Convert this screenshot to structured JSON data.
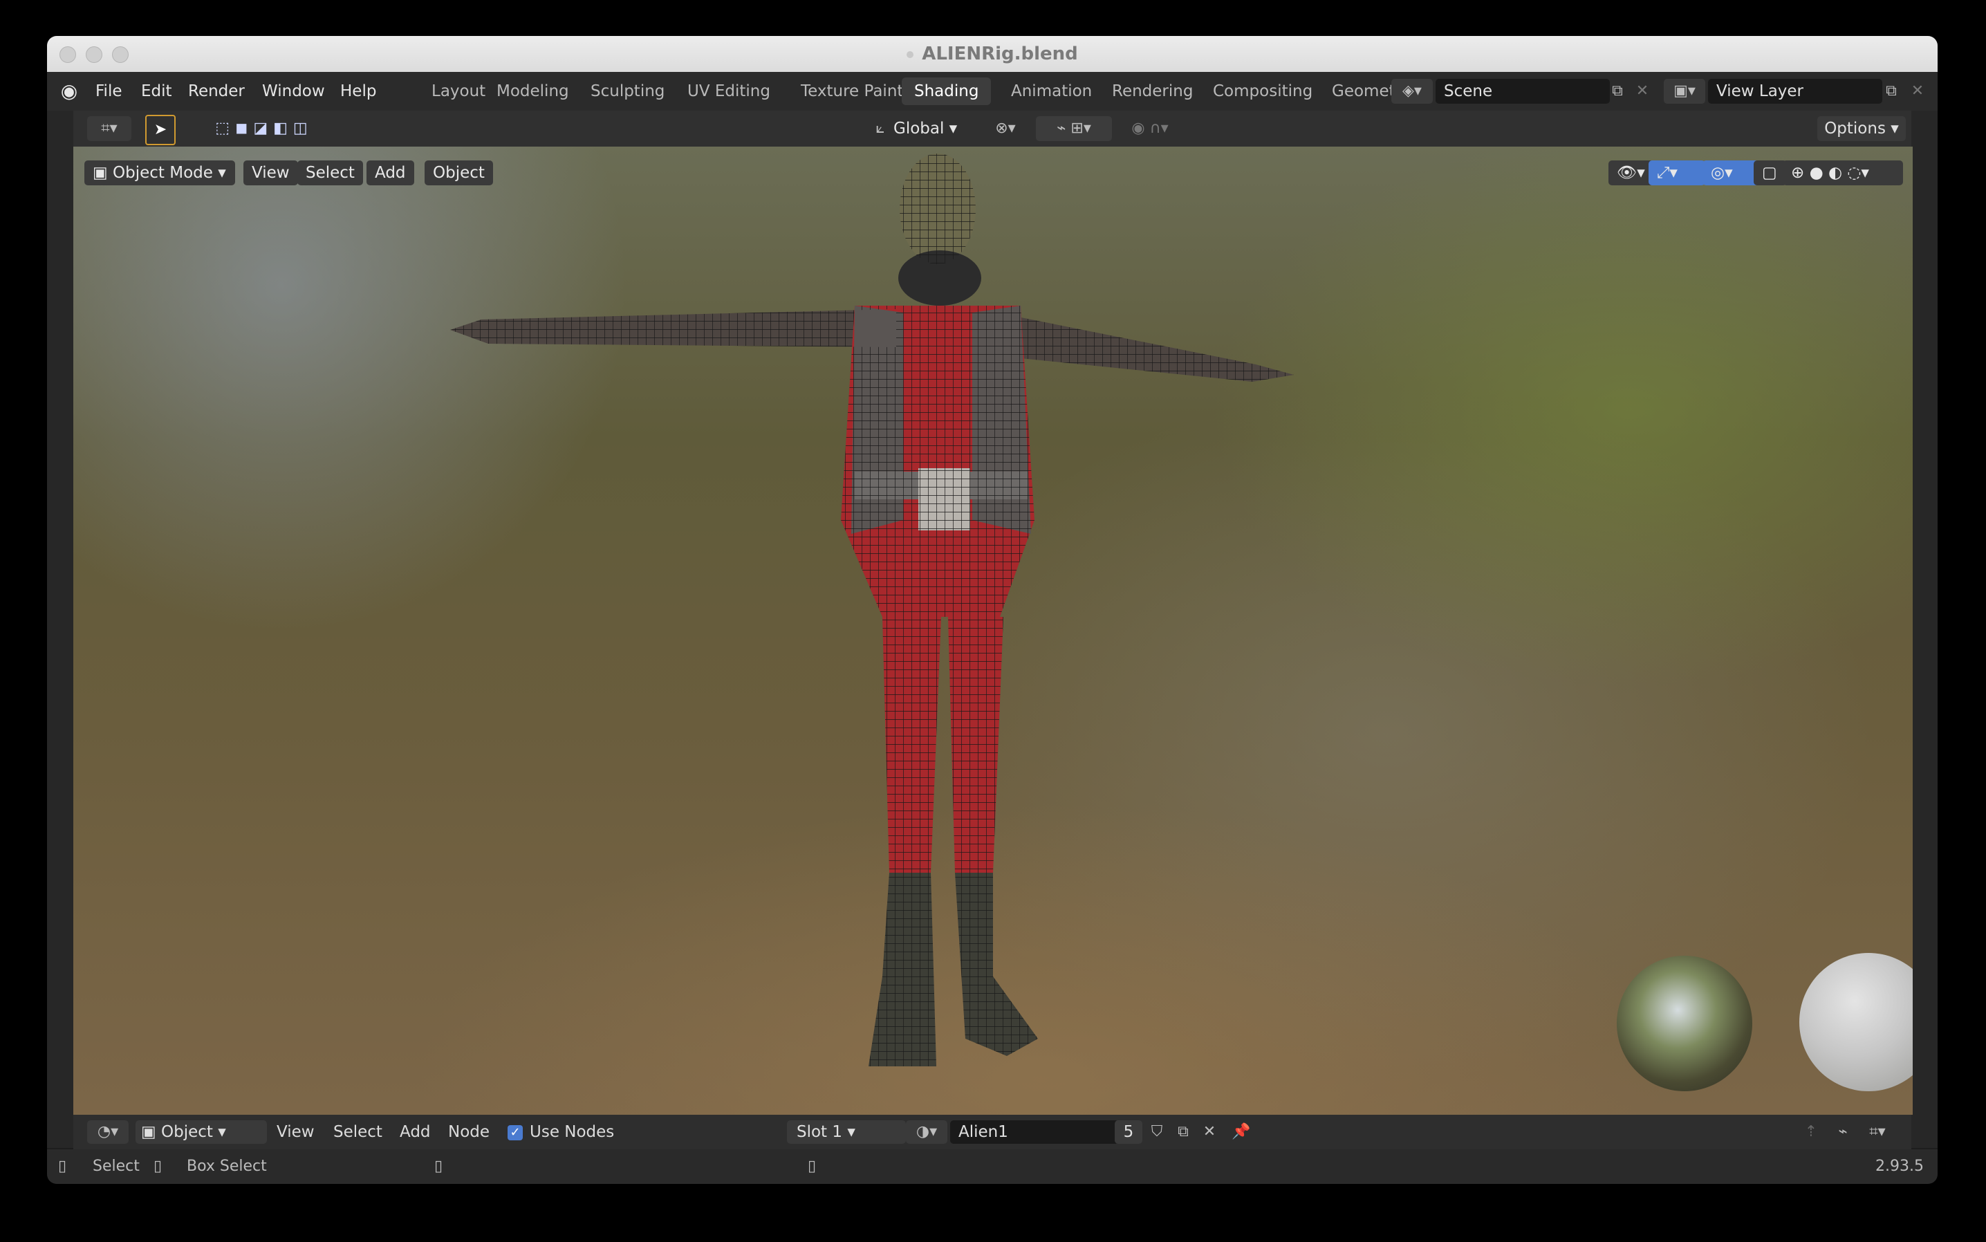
{
  "window": {
    "title": "ALIENRig.blend"
  },
  "menu": [
    "File",
    "Edit",
    "Render",
    "Window",
    "Help"
  ],
  "workspaces": {
    "tabs": [
      "Layout",
      "Modeling",
      "Sculpting",
      "UV Editing",
      "Texture Paint",
      "Shading",
      "Animation",
      "Rendering",
      "Compositing",
      "Geomet"
    ],
    "active": "Shading"
  },
  "scene": {
    "name": "Scene"
  },
  "view_layer": {
    "name": "View Layer"
  },
  "toolbar": {
    "orientation": "Global",
    "options_label": "Options"
  },
  "viewport": {
    "mode": "Object Mode",
    "menus": [
      "View",
      "Select",
      "Add",
      "Object"
    ]
  },
  "shader_header": {
    "object_type": "Object",
    "menus": [
      "View",
      "Select",
      "Add",
      "Node"
    ],
    "use_nodes_label": "Use Nodes",
    "use_nodes_checked": true,
    "slot": "Slot 1",
    "material_name": "Alien1",
    "user_count": "5"
  },
  "status": {
    "select_label": "Select",
    "box_select_label": "Box Select",
    "version": "2.93.5"
  },
  "colors": {
    "accent": "#4a7bd0",
    "window_bg": "#1d1d1d",
    "header_bg": "#2b2b2b",
    "suit_red": "#b22a2a",
    "checkbox_blue": "#4a7bd0"
  }
}
